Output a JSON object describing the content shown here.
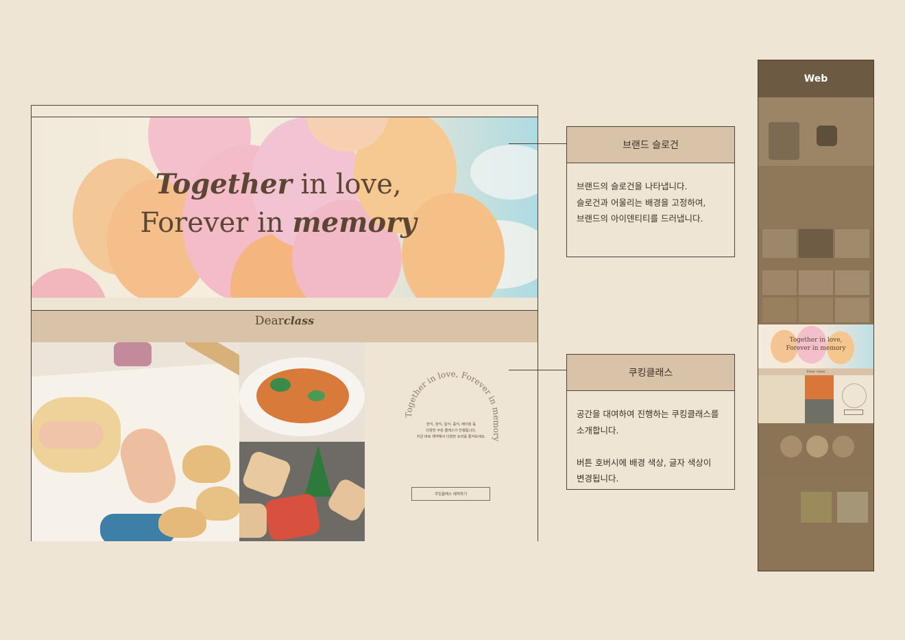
{
  "hero": {
    "title_script_1": "Together",
    "title_rest_1": " in love,",
    "title_rest_2": "Forever in ",
    "title_script_2": "memory"
  },
  "brand": {
    "dear": "Dear",
    "class": "class"
  },
  "class_section": {
    "arc_text": "Together in love, Forever in memory",
    "desc_line1": "한식, 양식, 일식, 중식, 베이킹 등",
    "desc_line2": "다양한 쿠킹 클래스가 진행됩니다.",
    "desc_line3": "지금 바로 예약해서 다양한 요리를 즐겨보세요.",
    "button_label": "쿠킹클래스 예약하기"
  },
  "annotations": [
    {
      "title": "브랜드 슬로건",
      "lines": [
        "브랜드의 슬로건을 나타냅니다.",
        "슬로건과 어울리는 배경을 고정하여,",
        "브랜드의 아이덴티티를 드러냅니다."
      ]
    },
    {
      "title": "쿠킹클래스",
      "lines": [
        "공간을 대여하여 진행하는 쿠킹클래스를",
        "소개합니다.",
        "",
        "버튼 호버시에 배경 색상, 글자 색상이",
        "변경됩니다."
      ]
    }
  ],
  "web_strip": {
    "label": "Web",
    "mini_title_1": "Together in love,",
    "mini_title_2": "Forever in memory",
    "mini_brand": "Dear class"
  },
  "colors": {
    "background": "#efe5d5",
    "accent": "#d9c3a8",
    "dark": "#6d5a42"
  }
}
